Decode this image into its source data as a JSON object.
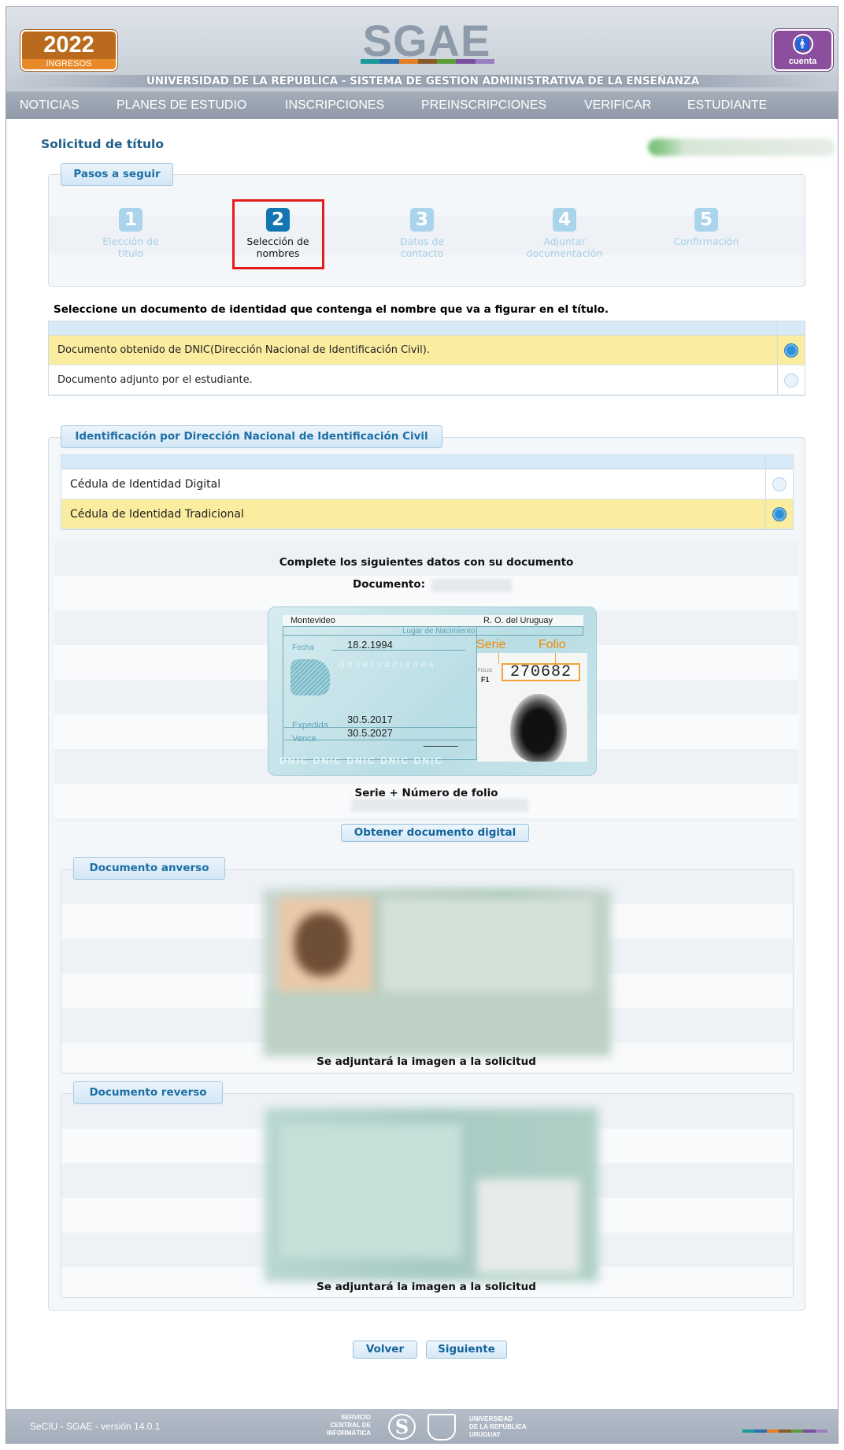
{
  "header": {
    "year_badge": "2022",
    "year_badge_sub": "INGRESOS",
    "logo": "SGAE",
    "logo_colors": [
      "#1a9a9a",
      "#2a6fb0",
      "#e67e22",
      "#8a5a2b",
      "#5a9e3a",
      "#7b4fa0",
      "#9b7fc0"
    ],
    "account_icon": "accessibility-person-icon",
    "account_label": "cuenta",
    "subtitle": "UNIVERSIDAD DE LA REPÚBLICA - SISTEMA DE GESTIÓN ADMINISTRATIVA DE LA ENSEÑANZA"
  },
  "nav": [
    "NOTICIAS",
    "PLANES DE ESTUDIO",
    "INSCRIPCIONES",
    "PREINSCRIPCIONES",
    "VERIFICAR",
    "ESTUDIANTE"
  ],
  "page": {
    "title": "Solicitud de título"
  },
  "steps": {
    "legend": "Pasos a seguir",
    "active_index": 1,
    "items": [
      {
        "num": "1",
        "label_1": "Elección de",
        "label_2": "título"
      },
      {
        "num": "2",
        "label_1": "Selección de",
        "label_2": "nombres"
      },
      {
        "num": "3",
        "label_1": "Datos de",
        "label_2": "contacto"
      },
      {
        "num": "4",
        "label_1": "Adjuntar",
        "label_2": "documentación"
      },
      {
        "num": "5",
        "label_1": "Confirmación",
        "label_2": ""
      }
    ]
  },
  "doc_select": {
    "instruction": "Seleccione un documento de identidad que contenga el nombre que va a figurar en el título.",
    "options": [
      {
        "label": "Documento obtenido de DNIC(Dirección Nacional de Identificación Civil).",
        "selected": true
      },
      {
        "label": "Documento adjunto por el estudiante.",
        "selected": false
      }
    ]
  },
  "dnic": {
    "legend": "Identificación por Dirección Nacional de Identificación Civil",
    "options": [
      {
        "label": "Cédula de Identidad Digital",
        "selected": false
      },
      {
        "label": "Cédula de Identidad Tradicional",
        "selected": true
      }
    ],
    "complete_text": "Complete los siguientes datos con su documento",
    "document_label": "Documento:",
    "id_card": {
      "city": "Montevideo",
      "country": "R. O. del Uruguay",
      "birthplace_label": "Lugar de Nacimiento",
      "date_label": "Fecha",
      "birth_date": "18.2.1994",
      "serie_label": "Serie",
      "folio_label": "Folio",
      "observaciones_label": "Observaciones:",
      "folio_prefix": "FOLIO",
      "serie_value": "F1",
      "folio_number": "270682",
      "expedida_label": "Expedida",
      "expedida_date": "30.5.2017",
      "vence_label": "Vence",
      "vence_date": "30.5.2027",
      "watermark": "DNIC DNIC DNIC DNIC DNIC"
    },
    "serie_folio_label": "Serie + Número de folio",
    "button_obtain": "Obtener documento digital"
  },
  "anverso": {
    "legend": "Documento anverso",
    "caption": "Se adjuntará la imagen a la solicitud"
  },
  "reverso": {
    "legend": "Documento reverso",
    "caption": "Se adjuntará la imagen a la solicitud"
  },
  "actions": {
    "back": "Volver",
    "next": "Siguiente"
  },
  "footer": {
    "version": "SeCIU - SGAE - versión 14.0.1",
    "sci_1": "SERVICIO",
    "sci_2": "CENTRAL DE",
    "sci_3": "INFORMÁTICA",
    "udelar_1": "UNIVERSIDAD",
    "udelar_2": "DE LA REPÚBLICA",
    "udelar_3": "URUGUAY",
    "color_strip": [
      "#1a9a9a",
      "#2a6fb0",
      "#e67e22",
      "#8a5a2b",
      "#5a9e3a",
      "#7b4fa0",
      "#9b7fc0"
    ]
  }
}
